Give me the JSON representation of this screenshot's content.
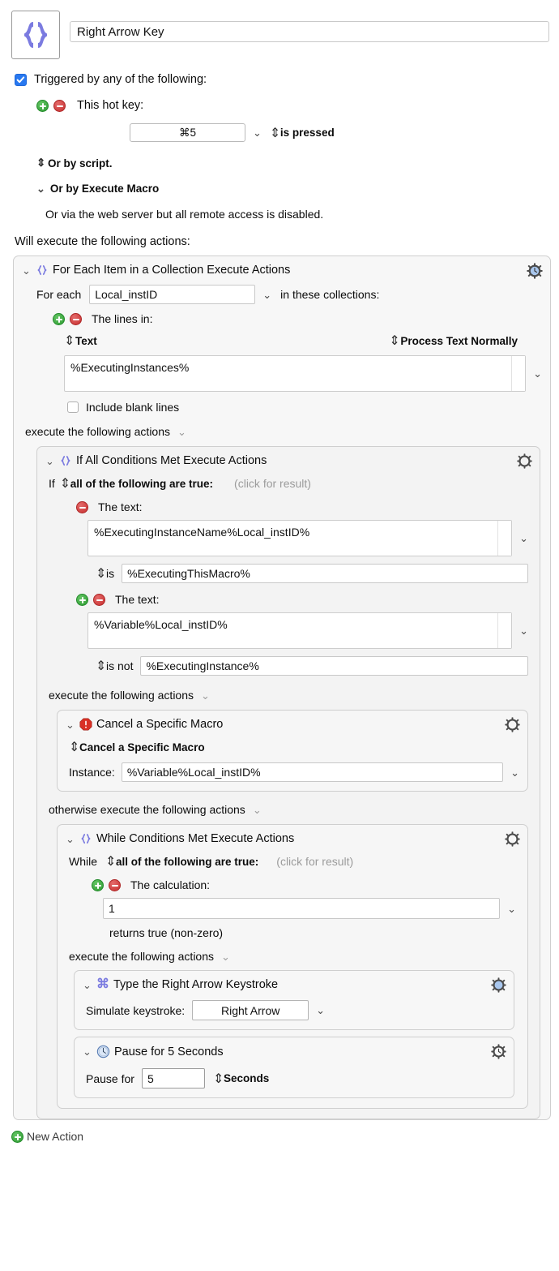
{
  "macro": {
    "icon": "braces-icon",
    "title_value": "Right Arrow Key",
    "title_placeholder": "Macro Name"
  },
  "trigger": {
    "checkbox_label": "Triggered by any of the following:",
    "checkbox_checked": true,
    "hotkey_label": "This hot key:",
    "hotkey_value": "⌘5",
    "hotkey_condition": "is pressed",
    "or_by_script": "Or by script.",
    "or_by_execute_macro": "Or by Execute Macro",
    "web_server_note": "Or via the web server but all remote access is disabled.",
    "will_execute": "Will execute the following actions:"
  },
  "actions": {
    "for_each": {
      "title": "For Each Item in a Collection Execute Actions",
      "icon": "braces-icon",
      "gear_icon": "gear-clock-icon",
      "for_each_label": "For each",
      "variable_value": "Local_instID",
      "in_collections_label": "in these collections:",
      "the_lines_in": "The lines in:",
      "source_popup": "Text",
      "processing_popup": "Process Text Normally",
      "text_value": "%ExecutingInstances%",
      "include_blank_lines": "Include blank lines",
      "include_blank_lines_checked": false,
      "execute_following": "execute the following actions"
    },
    "if_all": {
      "title": "If All Conditions Met Execute Actions",
      "icon": "braces-icon",
      "gear_icon": "gear-icon",
      "if_label": "If",
      "condition_mode": "all of the following are true:",
      "click_for_result": "(click for result)",
      "conditions": [
        {
          "label": "The text:",
          "value": "%ExecutingInstanceName%Local_instID%",
          "operator": "is",
          "operand": "%ExecutingThisMacro%",
          "has_add": false,
          "has_remove": true
        },
        {
          "label": "The text:",
          "value": "%Variable%Local_instID%",
          "operator": "is not",
          "operand": "%ExecutingInstance%",
          "has_add": true,
          "has_remove": true
        }
      ],
      "execute_following": "execute the following actions",
      "otherwise_execute": "otherwise execute the following actions"
    },
    "cancel_macro": {
      "title": "Cancel a Specific Macro",
      "icon": "stop-sign-icon",
      "gear_icon": "gear-icon",
      "type_popup": "Cancel a Specific Macro",
      "instance_label": "Instance:",
      "instance_value": "%Variable%Local_instID%"
    },
    "while_loop": {
      "title": "While Conditions Met Execute Actions",
      "icon": "braces-icon",
      "gear_icon": "gear-icon",
      "while_label": "While",
      "condition_mode": "all of the following are true:",
      "click_for_result": "(click for result)",
      "calculation_label": "The calculation:",
      "calculation_value": "1",
      "returns_true": "returns true (non-zero)",
      "execute_following": "execute the following actions"
    },
    "type_keystroke": {
      "title": "Type the Right Arrow Keystroke",
      "icon": "command-key-icon",
      "gear_icon": "gear-blue-icon",
      "simulate_label": "Simulate keystroke:",
      "keystroke_value": "Right Arrow"
    },
    "pause": {
      "title": "Pause for 5 Seconds",
      "icon": "clock-icon",
      "gear_icon": "gear-clock-icon",
      "pause_for_label": "Pause for",
      "pause_value": "5",
      "units_popup": "Seconds"
    }
  },
  "footer": {
    "new_action_label": "New Action",
    "new_action_icon": "plus-circle-icon"
  },
  "colors": {
    "accent_purple": "#7b7be0",
    "checkbox_blue": "#2878f0",
    "add_green": "#2f9c33",
    "remove_red": "#c72f2f",
    "stop_red": "#d93025",
    "gear_blue": "#a9c7ee"
  }
}
